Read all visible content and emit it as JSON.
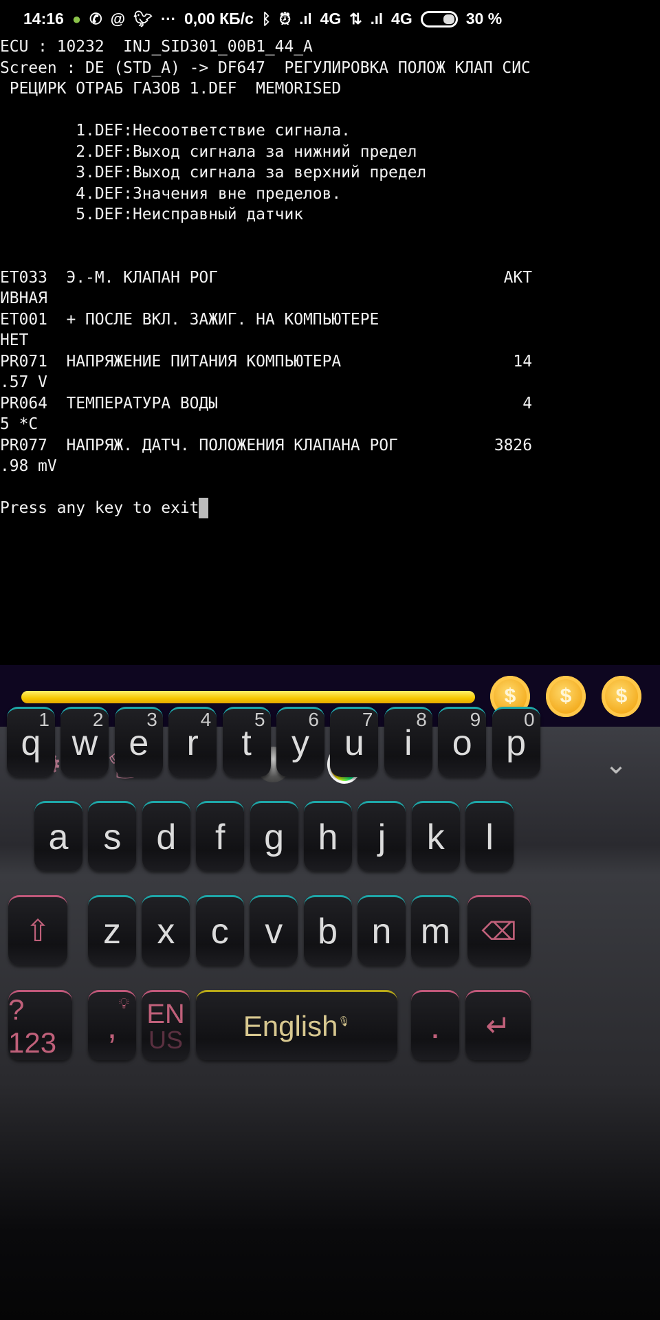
{
  "status_bar": {
    "time": "14:16",
    "net_speed": "0,00 КБ/с",
    "network1": "4G",
    "network2": "4G",
    "battery": "30 %",
    "battery_level": 30,
    "icons": [
      "notification-app-icon",
      "whatsapp-icon",
      "at-icon",
      "twitter-icon",
      "more-icon",
      "bluetooth-icon",
      "alarm-icon",
      "signal-icon",
      "data-arrows-icon",
      "signal-icon",
      "battery-icon"
    ]
  },
  "terminal": {
    "lines": [
      {
        "left": "ECU : 10232  INJ_SID301_00B1_44_A",
        "right": ""
      },
      {
        "left": "Screen : DE (STD_A) -> DF647  РЕГУЛИРОВКА ПОЛОЖ КЛАП СИС",
        "right": ""
      },
      {
        "left": " РЕЦИРК ОТРАБ ГАЗОВ 1.DEF  MEMORISED",
        "right": ""
      },
      {
        "left": "",
        "right": ""
      },
      {
        "left": "        1.DEF:Несоответствие сигнала.",
        "right": ""
      },
      {
        "left": "        2.DEF:Выход сигнала за нижний предел",
        "right": ""
      },
      {
        "left": "        3.DEF:Выход сигнала за верхний предел",
        "right": ""
      },
      {
        "left": "        4.DEF:Значения вне пределов.",
        "right": ""
      },
      {
        "left": "        5.DEF:Неисправный датчик",
        "right": ""
      },
      {
        "left": "",
        "right": ""
      },
      {
        "left": "",
        "right": ""
      },
      {
        "left": "ET033  Э.-М. КЛАПАН РОГ",
        "right": "АКТ"
      },
      {
        "left": "ИВНАЯ",
        "right": ""
      },
      {
        "left": "ET001  + ПОСЛЕ ВКЛ. ЗАЖИГ. НА КОМПЬЮТЕРЕ",
        "right": ""
      },
      {
        "left": "НЕТ",
        "right": ""
      },
      {
        "left": "PR071  НАПРЯЖЕНИЕ ПИТАНИЯ КОМПЬЮТЕРА",
        "right": "14"
      },
      {
        "left": ".57 V",
        "right": ""
      },
      {
        "left": "PR064  ТЕМПЕРАТУРА ВОДЫ",
        "right": "4"
      },
      {
        "left": "5 *C",
        "right": ""
      },
      {
        "left": "PR077  НАПРЯЖ. ДАТЧ. ПОЛОЖЕНИЯ КЛАПАНА РОГ",
        "right": "3826"
      },
      {
        "left": ".98 mV",
        "right": ""
      },
      {
        "left": "",
        "right": ""
      }
    ],
    "prompt": "Press any key to exit"
  },
  "reward_strip": {
    "progress": 100,
    "coin_symbol": "$",
    "coins": 3
  },
  "toolbar": {
    "icons": [
      "settings-icon",
      "theme-shirt-icon",
      "emoji-icon",
      "sphere-icon",
      "color-wheel-icon",
      "collapse-chevron-icon"
    ]
  },
  "keyboard": {
    "row1": [
      {
        "k": "q",
        "n": "1"
      },
      {
        "k": "w",
        "n": "2"
      },
      {
        "k": "e",
        "n": "3"
      },
      {
        "k": "r",
        "n": "4"
      },
      {
        "k": "t",
        "n": "5"
      },
      {
        "k": "y",
        "n": "6"
      },
      {
        "k": "u",
        "n": "7"
      },
      {
        "k": "i",
        "n": "8"
      },
      {
        "k": "o",
        "n": "9"
      },
      {
        "k": "p",
        "n": "0"
      }
    ],
    "row2": [
      "a",
      "s",
      "d",
      "f",
      "g",
      "h",
      "j",
      "k",
      "l"
    ],
    "row3": [
      "z",
      "x",
      "c",
      "v",
      "b",
      "n",
      "m"
    ],
    "symbols": "?123",
    "comma": ",",
    "lang_top": "EN",
    "lang_bottom": "US",
    "space": "English",
    "period": ".",
    "colors": {
      "teal": "#1ea7a8",
      "pink": "#c0587a",
      "gold": "#b8a818"
    }
  }
}
